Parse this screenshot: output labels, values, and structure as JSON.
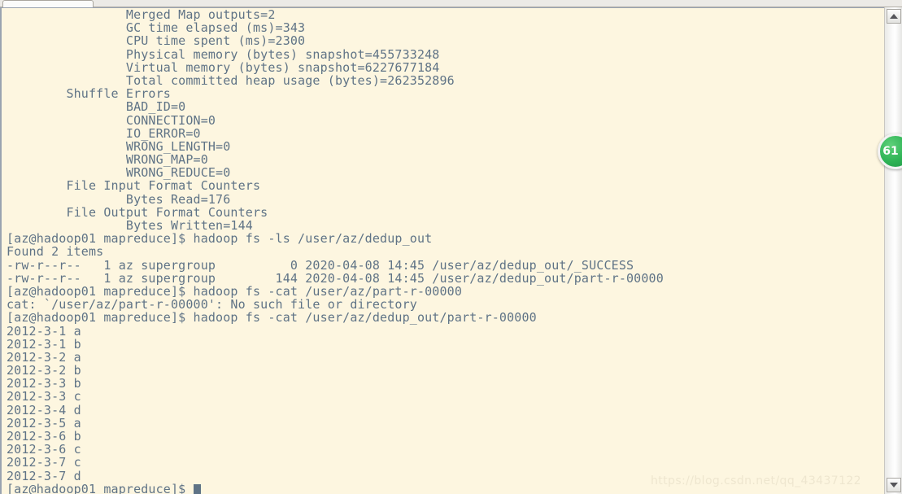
{
  "window": {
    "tab_label": "",
    "background_color": "#fdf6e0",
    "text_color": "#5f7386"
  },
  "terminal": {
    "lines": [
      "                Merged Map outputs=2",
      "                GC time elapsed (ms)=343",
      "                CPU time spent (ms)=2300",
      "                Physical memory (bytes) snapshot=455733248",
      "                Virtual memory (bytes) snapshot=6227677184",
      "                Total committed heap usage (bytes)=262352896",
      "        Shuffle Errors",
      "                BAD_ID=0",
      "                CONNECTION=0",
      "                IO_ERROR=0",
      "                WRONG_LENGTH=0",
      "                WRONG_MAP=0",
      "                WRONG_REDUCE=0",
      "        File Input Format Counters ",
      "                Bytes Read=176",
      "        File Output Format Counters ",
      "                Bytes Written=144",
      "[az@hadoop01 mapreduce]$ hadoop fs -ls /user/az/dedup_out",
      "Found 2 items",
      "-rw-r--r--   1 az supergroup          0 2020-04-08 14:45 /user/az/dedup_out/_SUCCESS",
      "-rw-r--r--   1 az supergroup        144 2020-04-08 14:45 /user/az/dedup_out/part-r-00000",
      "[az@hadoop01 mapreduce]$ hadoop fs -cat /user/az/part-r-00000",
      "cat: `/user/az/part-r-00000': No such file or directory",
      "[az@hadoop01 mapreduce]$ hadoop fs -cat /user/az/dedup_out/part-r-00000",
      "2012-3-1 a",
      "2012-3-1 b",
      "2012-3-2 a",
      "2012-3-2 b",
      "2012-3-3 b",
      "2012-3-3 c",
      "2012-3-4 d",
      "2012-3-5 a",
      "2012-3-6 b",
      "2012-3-6 c",
      "2012-3-7 c",
      "2012-3-7 d"
    ],
    "prompt": "[az@hadoop01 mapreduce]$ "
  },
  "scrollbar": {
    "up_arrow_icon": "scroll-up-arrow-icon",
    "down_arrow_icon": "scroll-down-arrow-icon"
  },
  "badge": {
    "label": "61",
    "color": "#2eb355"
  },
  "watermark": {
    "text": "https://blog.csdn.net/qq_43437122"
  }
}
